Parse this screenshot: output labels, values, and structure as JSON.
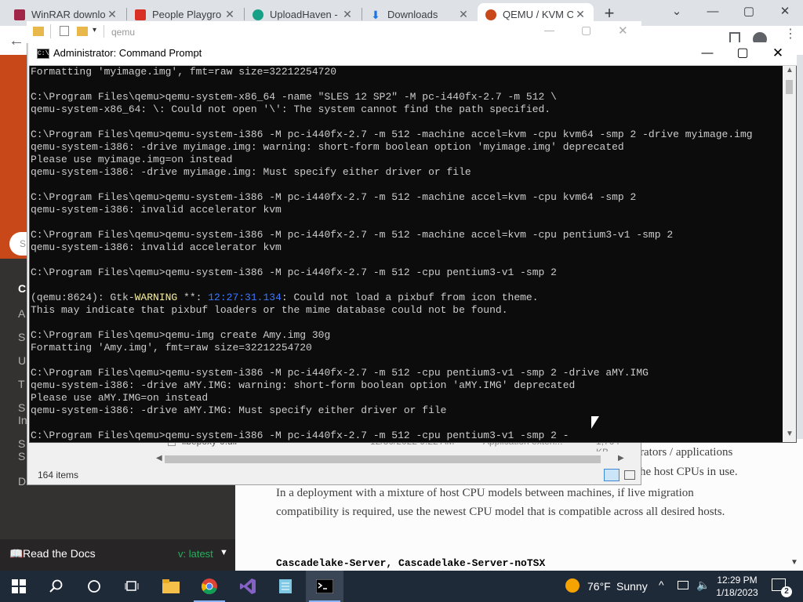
{
  "browser": {
    "tabs": [
      {
        "title": "WinRAR downlo",
        "color": "#a1264a"
      },
      {
        "title": "People Playgro",
        "color": "#d93025"
      },
      {
        "title": "UploadHaven -",
        "color": "#16a085"
      },
      {
        "title": "Downloads",
        "color": "#1a73e8"
      },
      {
        "title": "QEMU / KVM C",
        "color": "#c9481a",
        "active": true
      }
    ],
    "new_tab": "+",
    "controls": {
      "minimize": "—",
      "maximize": "▢",
      "close": "✕",
      "dropdown": "⌄"
    },
    "back": "←"
  },
  "explorer": {
    "title_path": "qemu",
    "status": "164 items",
    "file_row": {
      "name": "libepoxy-0.dll",
      "date": "12/30/2022 9:22 AM",
      "type": "Application exten...",
      "size": "1,764 KB"
    }
  },
  "cmd": {
    "title": "Administrator: Command Prompt",
    "lines": [
      "Formatting 'myimage.img', fmt=raw size=32212254720",
      "",
      "C:\\Program Files\\qemu>qemu-system-x86_64 -name \"SLES 12 SP2\" -M pc-i440fx-2.7 -m 512 \\",
      "qemu-system-x86_64: \\: Could not open '\\': The system cannot find the path specified.",
      "",
      "C:\\Program Files\\qemu>qemu-system-i386 -M pc-i440fx-2.7 -m 512 -machine accel=kvm -cpu kvm64 -smp 2 -drive myimage.img",
      "qemu-system-i386: -drive myimage.img: warning: short-form boolean option 'myimage.img' deprecated",
      "Please use myimage.img=on instead",
      "qemu-system-i386: -drive myimage.img: Must specify either driver or file",
      "",
      "C:\\Program Files\\qemu>qemu-system-i386 -M pc-i440fx-2.7 -m 512 -machine accel=kvm -cpu kvm64 -smp 2",
      "qemu-system-i386: invalid accelerator kvm",
      "",
      "C:\\Program Files\\qemu>qemu-system-i386 -M pc-i440fx-2.7 -m 512 -machine accel=kvm -cpu pentium3-v1 -smp 2",
      "qemu-system-i386: invalid accelerator kvm",
      "",
      "C:\\Program Files\\qemu>qemu-system-i386 -M pc-i440fx-2.7 -m 512 -cpu pentium3-v1 -smp 2",
      "",
      "__GTK__",
      "This may indicate that pixbuf loaders or the mime database could not be found.",
      "",
      "C:\\Program Files\\qemu>qemu-img create Amy.img 30g",
      "Formatting 'Amy.img', fmt=raw size=32212254720",
      "",
      "C:\\Program Files\\qemu>qemu-system-i386 -M pc-i440fx-2.7 -m 512 -cpu pentium3-v1 -smp 2 -drive aMY.IMG",
      "qemu-system-i386: -drive aMY.IMG: warning: short-form boolean option 'aMY.IMG' deprecated",
      "Please use aMY.IMG=on instead",
      "qemu-system-i386: -drive aMY.IMG: Must specify either driver or file",
      "",
      "C:\\Program Files\\qemu>qemu-system-i386 -M pc-i440fx-2.7 -m 512 -cpu pentium3-v1 -smp 2 -"
    ],
    "gtk": {
      "prefix": "(qemu:8624): Gtk-",
      "warning": "WARNING",
      "stars": " **: ",
      "time": "12:27:31.134",
      "msg": ": Could not load a pixbuf from icon theme."
    }
  },
  "rtd": {
    "sidebar_letters": [
      "C",
      "A",
      "S",
      "U",
      "T",
      "S",
      "In",
      "S",
      "S",
      "D"
    ],
    "footer_label": "Read the Docs",
    "version": "v: latest"
  },
  "page": {
    "partial1": "rators / applications",
    "partial2": "he host CPUs in use.",
    "para": "In a deployment with a mixture of host CPU models between machines, if live migration compatibility is required, use the newest CPU model that is compatible across all desired hosts.",
    "code": "Cascadelake-Server, Cascadelake-Server-noTSX"
  },
  "taskbar": {
    "weather_temp": "76°F",
    "weather_desc": "Sunny",
    "time": "12:29 PM",
    "date": "1/18/2023",
    "notification_count": "2"
  }
}
